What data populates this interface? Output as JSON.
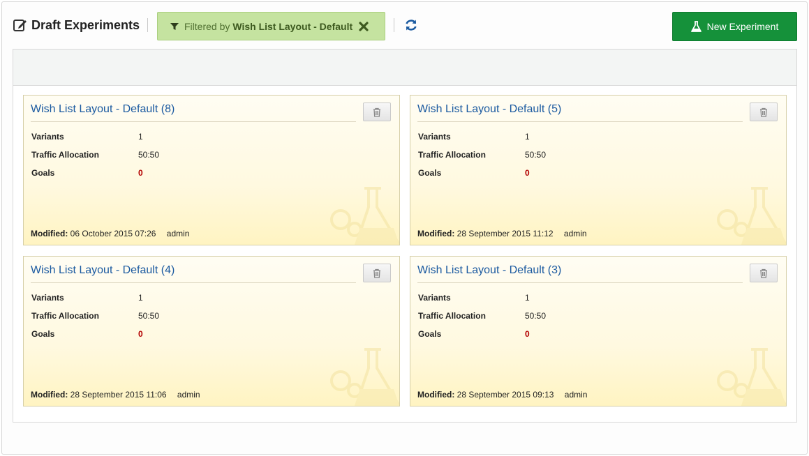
{
  "header": {
    "title": "Draft Experiments",
    "filter": {
      "prefix": "Filtered by",
      "name": "Wish List Layout - Default"
    },
    "new_button_label": "New Experiment"
  },
  "labels": {
    "variants": "Variants",
    "traffic": "Traffic Allocation",
    "goals": "Goals",
    "modified": "Modified:"
  },
  "cards": [
    {
      "title": "Wish List Layout - Default (8)",
      "variants": "1",
      "traffic": "50:50",
      "goals": "0",
      "modified_date": "06 October 2015 07:26",
      "user": "admin"
    },
    {
      "title": "Wish List Layout - Default (5)",
      "variants": "1",
      "traffic": "50:50",
      "goals": "0",
      "modified_date": "28 September 2015 11:12",
      "user": "admin"
    },
    {
      "title": "Wish List Layout - Default (4)",
      "variants": "1",
      "traffic": "50:50",
      "goals": "0",
      "modified_date": "28 September 2015 11:06",
      "user": "admin"
    },
    {
      "title": "Wish List Layout - Default (3)",
      "variants": "1",
      "traffic": "50:50",
      "goals": "0",
      "modified_date": "28 September 2015 09:13",
      "user": "admin"
    }
  ],
  "colors": {
    "accent_green": "#15913a",
    "filter_bg": "#c5e3a0",
    "link_blue": "#1b5aa0",
    "goals_red": "#b30000"
  }
}
